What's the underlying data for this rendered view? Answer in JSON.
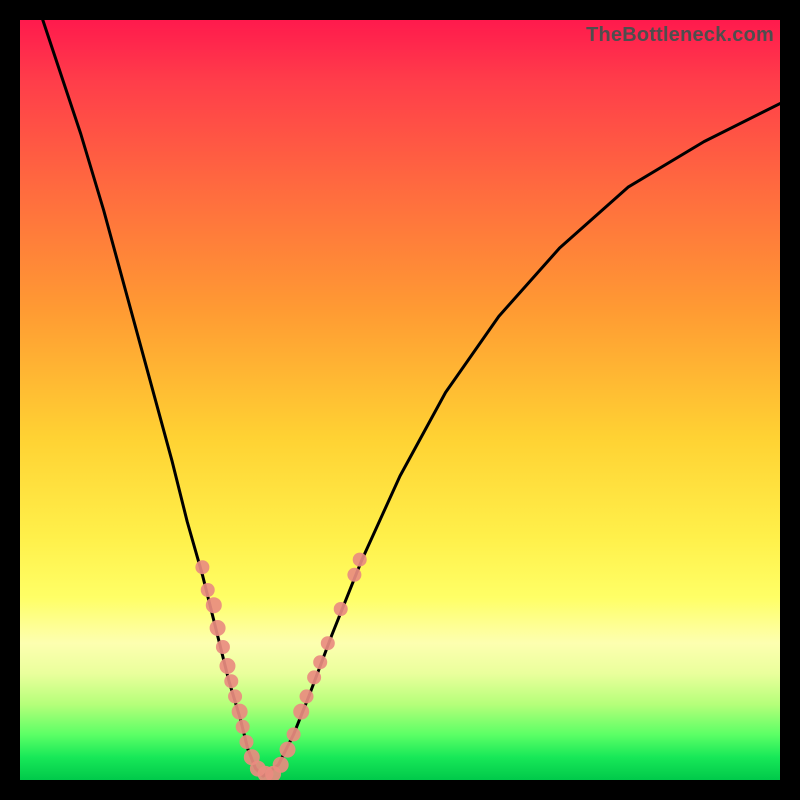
{
  "watermark": "TheBottleneck.com",
  "colors": {
    "background": "#000000",
    "curve": "#000000",
    "marker_fill": "#e98c80",
    "marker_stroke": "#e98c80"
  },
  "chart_data": {
    "type": "line",
    "title": "",
    "xlabel": "",
    "ylabel": "",
    "xlim": [
      0,
      100
    ],
    "ylim": [
      0,
      100
    ],
    "grid": false,
    "series": [
      {
        "name": "left-branch",
        "x": [
          3,
          5,
          8,
          11,
          14,
          17,
          20,
          22,
          24,
          26,
          27.5,
          29,
          30,
          31,
          32
        ],
        "y": [
          100,
          94,
          85,
          75,
          64,
          53,
          42,
          34,
          27,
          19,
          13,
          8,
          4,
          1.5,
          0.5
        ]
      },
      {
        "name": "right-branch",
        "x": [
          32,
          34,
          36,
          38,
          41,
          45,
          50,
          56,
          63,
          71,
          80,
          90,
          100
        ],
        "y": [
          0.5,
          2,
          6,
          11,
          19,
          29,
          40,
          51,
          61,
          70,
          78,
          84,
          89
        ]
      }
    ],
    "markers": [
      {
        "x": 24.0,
        "y": 28.0,
        "r": 7
      },
      {
        "x": 24.7,
        "y": 25.0,
        "r": 7
      },
      {
        "x": 25.5,
        "y": 23.0,
        "r": 8
      },
      {
        "x": 26.0,
        "y": 20.0,
        "r": 8
      },
      {
        "x": 26.7,
        "y": 17.5,
        "r": 7
      },
      {
        "x": 27.3,
        "y": 15.0,
        "r": 8
      },
      {
        "x": 27.8,
        "y": 13.0,
        "r": 7
      },
      {
        "x": 28.3,
        "y": 11.0,
        "r": 7
      },
      {
        "x": 28.9,
        "y": 9.0,
        "r": 8
      },
      {
        "x": 29.3,
        "y": 7.0,
        "r": 7
      },
      {
        "x": 29.8,
        "y": 5.0,
        "r": 7
      },
      {
        "x": 30.5,
        "y": 3.0,
        "r": 8
      },
      {
        "x": 31.3,
        "y": 1.5,
        "r": 8
      },
      {
        "x": 32.3,
        "y": 0.8,
        "r": 8
      },
      {
        "x": 33.3,
        "y": 0.8,
        "r": 8
      },
      {
        "x": 34.3,
        "y": 2.0,
        "r": 8
      },
      {
        "x": 35.2,
        "y": 4.0,
        "r": 8
      },
      {
        "x": 36.0,
        "y": 6.0,
        "r": 7
      },
      {
        "x": 37.0,
        "y": 9.0,
        "r": 8
      },
      {
        "x": 37.7,
        "y": 11.0,
        "r": 7
      },
      {
        "x": 38.7,
        "y": 13.5,
        "r": 7
      },
      {
        "x": 39.5,
        "y": 15.5,
        "r": 7
      },
      {
        "x": 40.5,
        "y": 18.0,
        "r": 7
      },
      {
        "x": 42.2,
        "y": 22.5,
        "r": 7
      },
      {
        "x": 44.0,
        "y": 27.0,
        "r": 7
      },
      {
        "x": 44.7,
        "y": 29.0,
        "r": 7
      }
    ],
    "annotations": []
  }
}
